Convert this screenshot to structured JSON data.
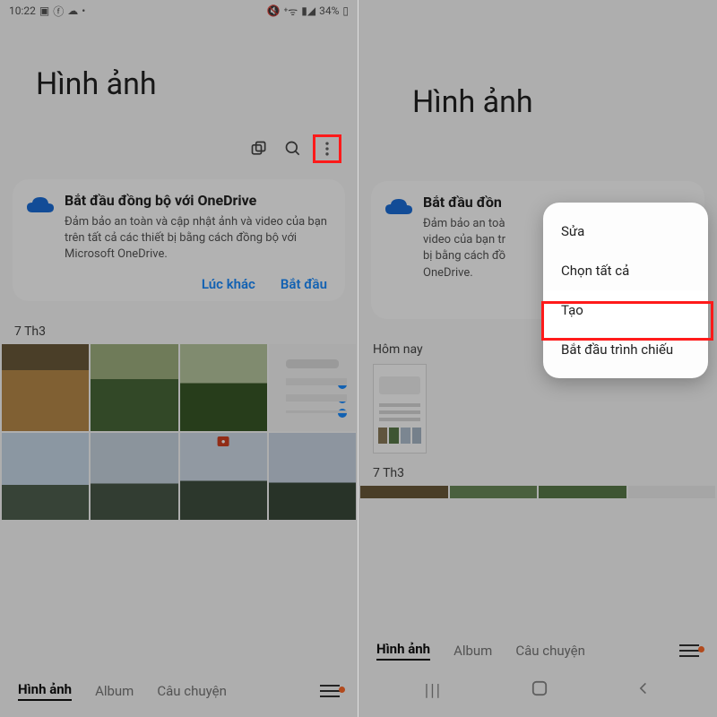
{
  "status_bar": {
    "time": "10:22",
    "battery": "34%",
    "icons": {
      "image": "image-icon",
      "fb": "facebook-icon",
      "cloud": "cloud-icon",
      "mute": "mute-icon",
      "wifi": "wifi-off-icon",
      "signal": "signal-icon"
    }
  },
  "header": {
    "title": "Hình ảnh"
  },
  "toolbar": {
    "copy_icon": "copy-icon",
    "search_icon": "search-icon",
    "overflow_icon": "overflow-menu-icon"
  },
  "onedrive_card": {
    "title": "Bắt đầu đồng bộ với OneDrive",
    "title_truncated": "Bắt đầu đồn",
    "desc": "Đảm bảo an toàn và cập nhật ảnh và video của bạn trên tất cả các thiết bị bằng cách đồng bộ với Microsoft OneDrive.",
    "desc_truncated": "Đảm bảo an toà\nvideo của bạn tr\nbị bằng cách đồ\nOneDrive.",
    "later": "Lúc khác",
    "start": "Bắt đầu"
  },
  "sections": {
    "left_date": "7 Th3",
    "right_today": "Hôm nay",
    "right_date": "7 Th3"
  },
  "tabs": {
    "photos": "Hình ảnh",
    "album": "Album",
    "stories": "Câu chuyện"
  },
  "dropdown": {
    "edit": "Sửa",
    "select_all": "Chọn tất cả",
    "create": "Tạo",
    "slideshow": "Bắt đầu trình chiếu"
  },
  "nav": {
    "recent": "|||",
    "home": "◯",
    "back": "‹"
  }
}
